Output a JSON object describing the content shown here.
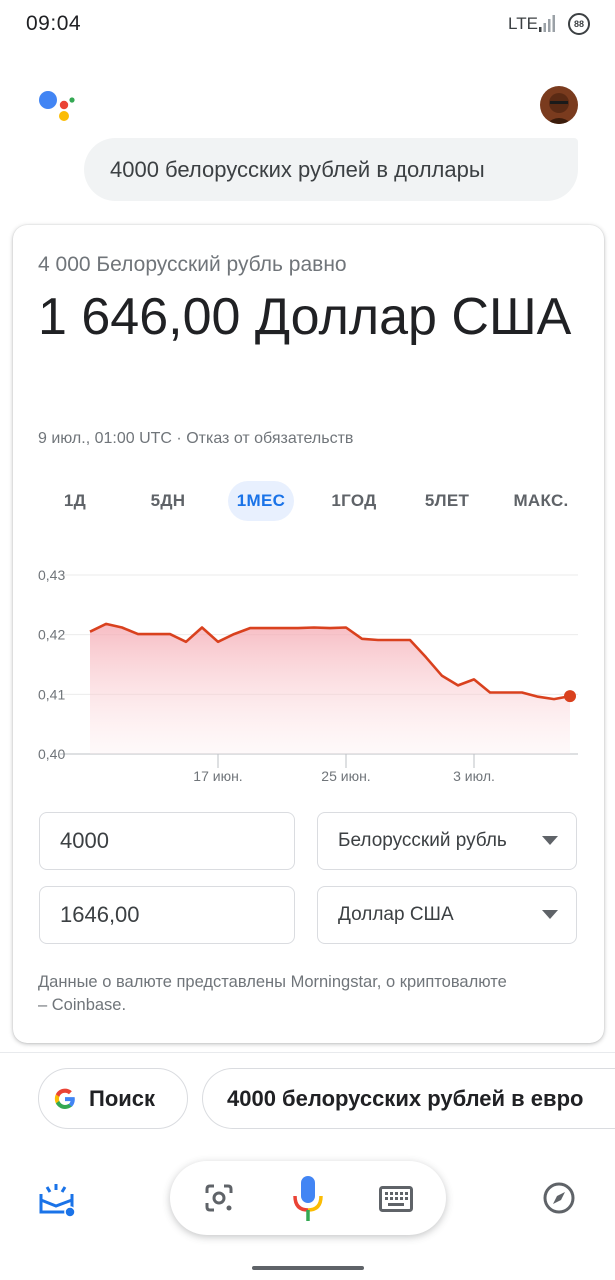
{
  "status_bar": {
    "time": "09:04",
    "network": "LTE",
    "battery": "88"
  },
  "assistant": {
    "query": "4000 белорусских рублей в доллары"
  },
  "converter": {
    "subtitle": "4 000 Белорусский рубль равно",
    "result": "1 646,00 Доллар США",
    "timestamp": "9 июл., 01:00 UTC · Отказ от обязательств",
    "tabs": [
      "1Д",
      "5ДН",
      "1МЕС",
      "1ГОД",
      "5ЛЕТ",
      "МАКС."
    ],
    "active_tab": "1МЕС",
    "from_amount": "4000",
    "from_currency": "Белорусский рубль",
    "to_amount": "1646,00",
    "to_currency": "Доллар США",
    "disclaimer": "Данные о валюте представлены Morningstar, о криптовалюте – Coinbase."
  },
  "chart_data": {
    "type": "area",
    "x_tick_labels": [
      "17 июн.",
      "25 июн.",
      "3 июл."
    ],
    "y_tick_labels": [
      "0,43",
      "0,42",
      "0,41",
      "0,40"
    ],
    "ylim": [
      0.4,
      0.43
    ],
    "values": [
      0.4205,
      0.4218,
      0.4212,
      0.4201,
      0.4201,
      0.4201,
      0.4188,
      0.4212,
      0.4188,
      0.4201,
      0.4211,
      0.4211,
      0.4211,
      0.4211,
      0.4212,
      0.4211,
      0.4212,
      0.4193,
      0.4191,
      0.4191,
      0.4191,
      0.4162,
      0.4131,
      0.4115,
      0.4125,
      0.4103,
      0.4103,
      0.4103,
      0.4096,
      0.4092,
      0.4097
    ],
    "x_tick_indices": [
      8,
      16,
      24
    ],
    "line_color": "#d9411e",
    "fill_color": "#f6c3c8",
    "grid": true
  },
  "suggestions": {
    "search_label": "Поиск",
    "suggestion_2": "4000 белорусских рублей в евро"
  },
  "colors": {
    "accent_blue": "#1a73e8",
    "google_red": "#ea4335",
    "google_yellow": "#fbbc04",
    "google_green": "#34a853"
  },
  "icons": [
    "google-assistant-logo-icon",
    "avatar",
    "google-g-icon",
    "snapshot-icon",
    "lens-icon",
    "mic-icon",
    "keyboard-icon",
    "compass-icon"
  ]
}
